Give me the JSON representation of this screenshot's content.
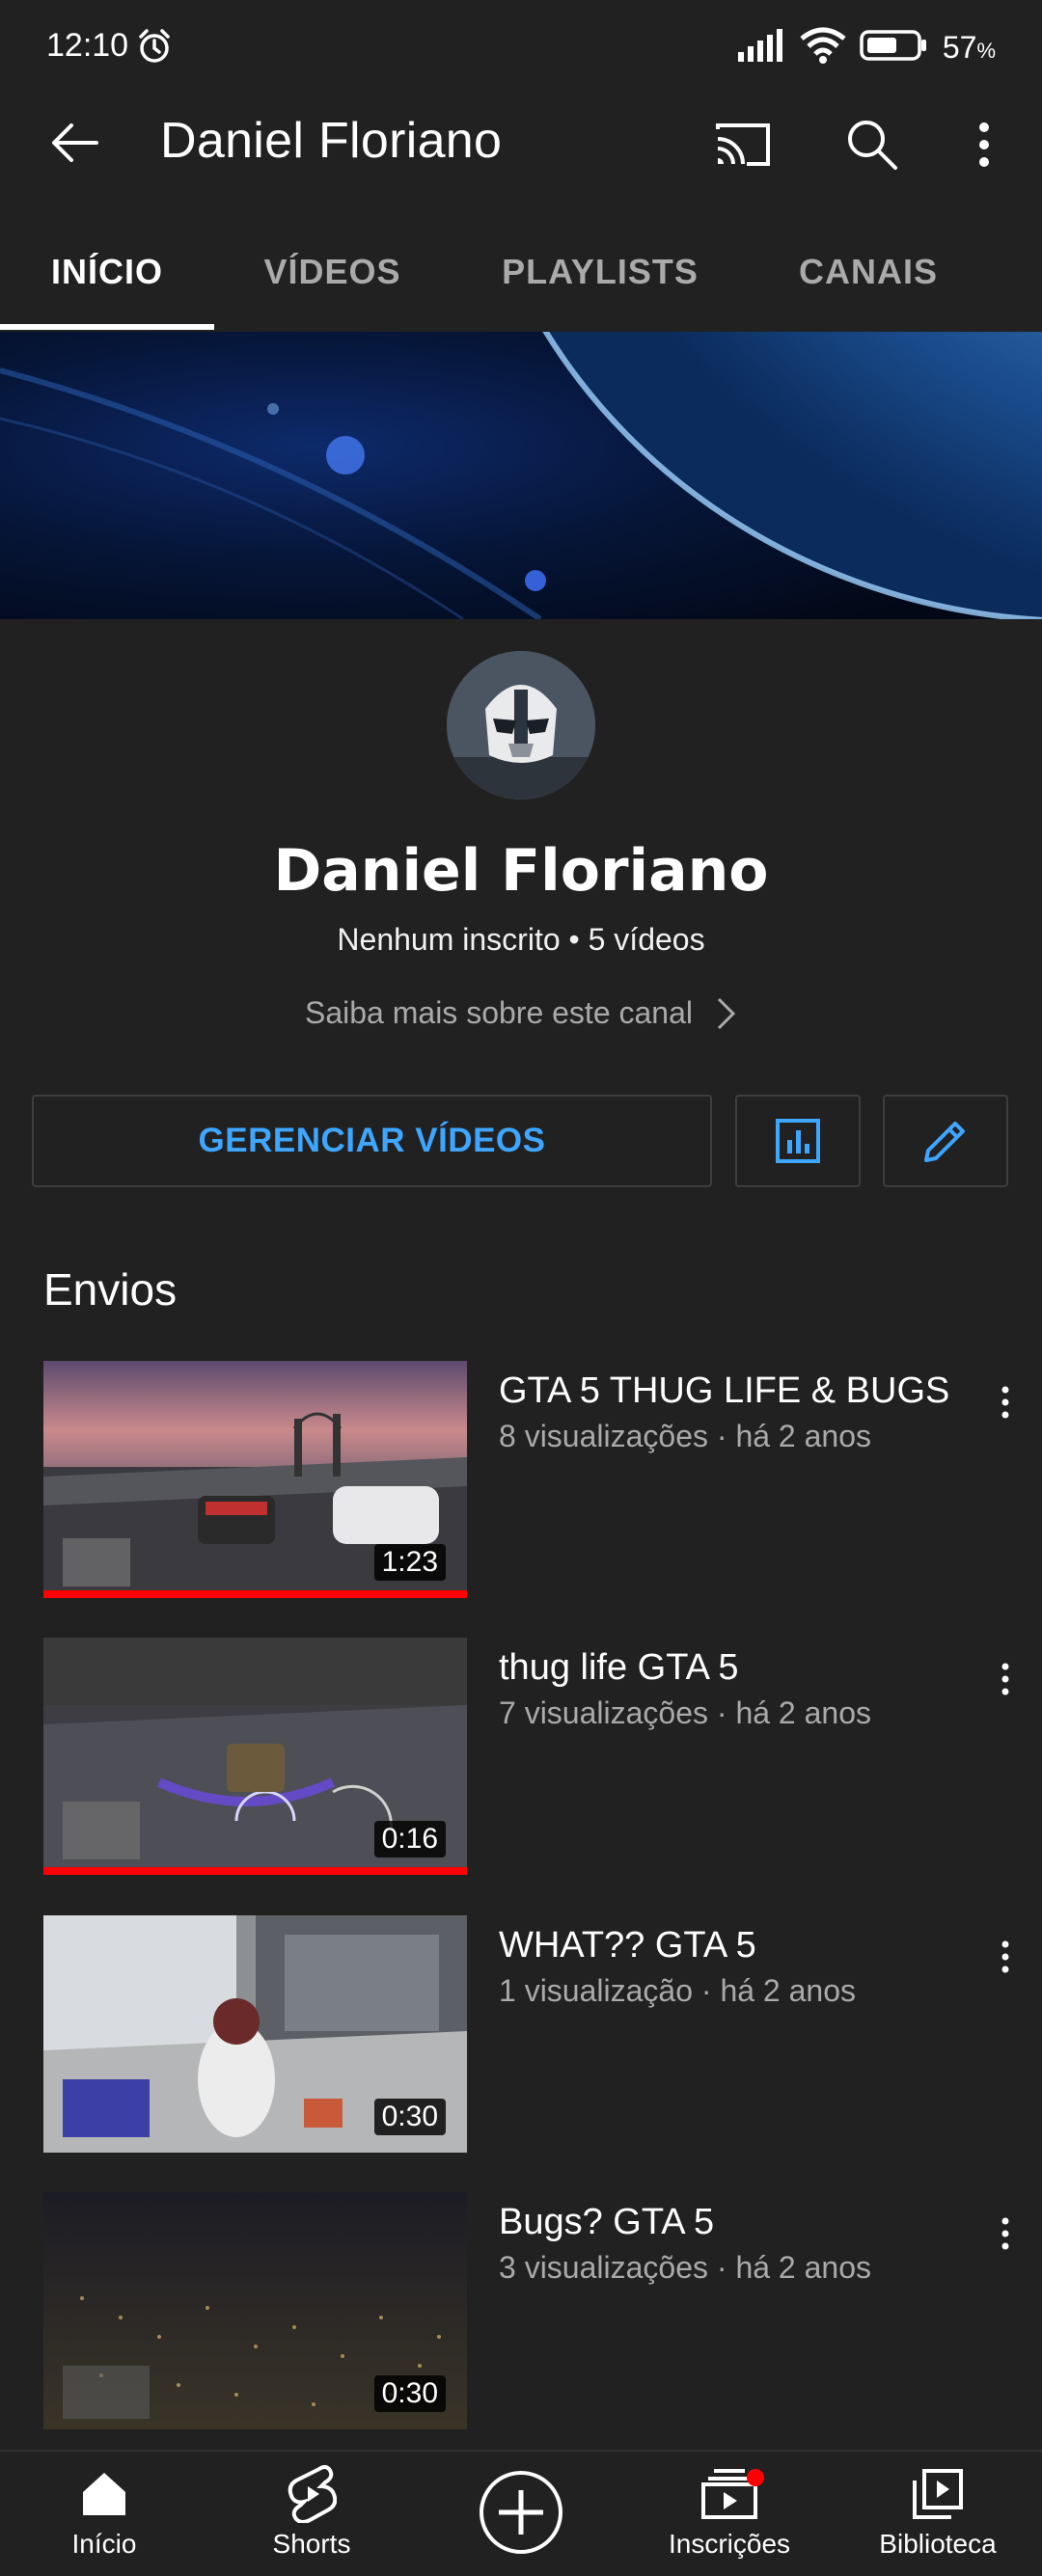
{
  "status_bar": {
    "time": "12:10",
    "battery_percent": "57",
    "battery_percent_sign": "%"
  },
  "app_bar": {
    "title": "Daniel Floriano"
  },
  "tabs": [
    {
      "label": "INÍCIO",
      "active": true
    },
    {
      "label": "VÍDEOS",
      "active": false
    },
    {
      "label": "PLAYLISTS",
      "active": false
    },
    {
      "label": "CANAIS",
      "active": false
    }
  ],
  "channel": {
    "name": "Daniel Floriano",
    "stats": "Nenhum inscrito • 5 vídeos",
    "about_link": "Saiba mais sobre este canal"
  },
  "actions": {
    "manage_label": "GERENCIAR VÍDEOS"
  },
  "uploads": {
    "section_title": "Envios",
    "videos": [
      {
        "title": "GTA 5 THUG LIFE & BUGS",
        "meta": "8 visualizações · há 2 anos",
        "duration": "1:23",
        "watched": 1.0
      },
      {
        "title": "thug life GTA 5",
        "meta": "7 visualizações · há 2 anos",
        "duration": "0:16",
        "watched": 1.0
      },
      {
        "title": "WHAT?? GTA 5",
        "meta": "1 visualização · há 2 anos",
        "duration": "0:30",
        "watched": 0
      },
      {
        "title": "Bugs? GTA 5",
        "meta": "3 visualizações · há 2 anos",
        "duration": "0:30",
        "watched": 0
      }
    ]
  },
  "bottom_nav": [
    {
      "label": "Início"
    },
    {
      "label": "Shorts"
    },
    {
      "label": ""
    },
    {
      "label": "Inscrições"
    },
    {
      "label": "Biblioteca"
    }
  ],
  "colors": {
    "background": "#212121",
    "accent_blue": "#3ea6ff",
    "progress_red": "#ff0000",
    "notification_dot": "#ff0000"
  }
}
